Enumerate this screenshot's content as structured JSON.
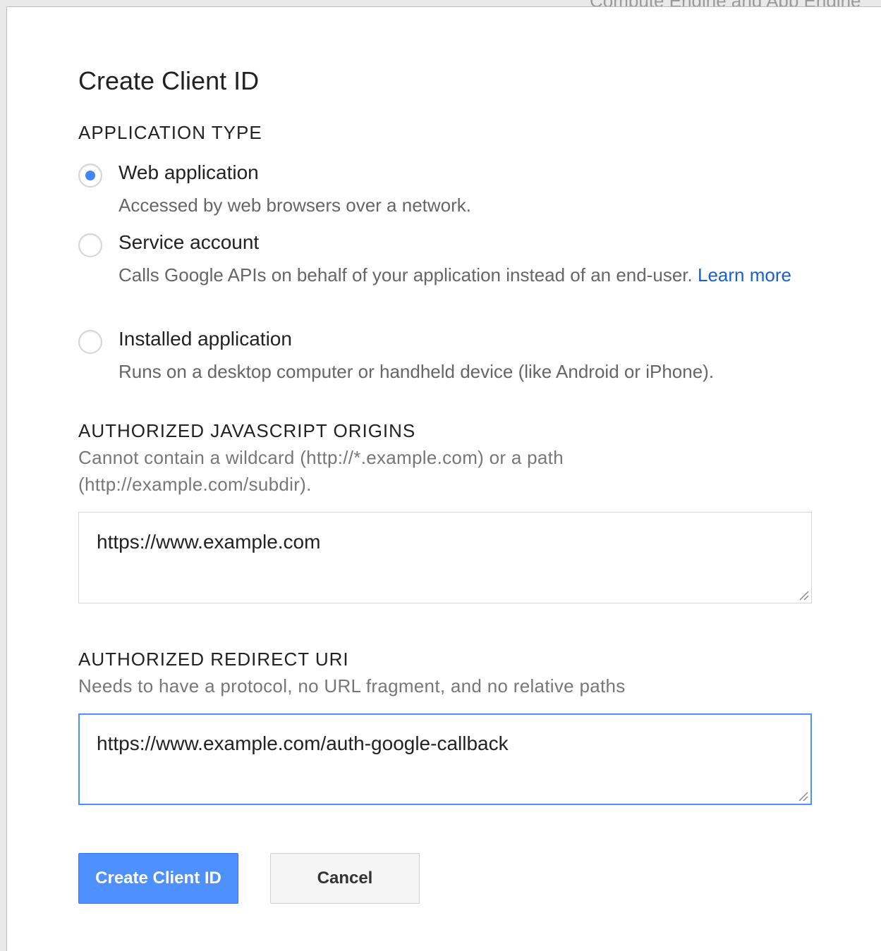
{
  "background": {
    "peek_text": "Compute Engine and App Engine"
  },
  "dialog": {
    "title": "Create Client ID",
    "application_type": {
      "label": "APPLICATION TYPE",
      "options": [
        {
          "label": "Web application",
          "description": "Accessed by web browsers over a network.",
          "checked": true
        },
        {
          "label": "Service account",
          "description": "Calls Google APIs on behalf of your application instead of an end-user.",
          "link_text": "Learn more",
          "checked": false
        },
        {
          "label": "Installed application",
          "description": "Runs on a desktop computer or handheld device (like Android or iPhone).",
          "checked": false
        }
      ]
    },
    "origins": {
      "label": "AUTHORIZED JAVASCRIPT ORIGINS",
      "help": "Cannot contain a wildcard (http://*.example.com) or a path (http://example.com/subdir).",
      "value": "https://www.example.com"
    },
    "redirect": {
      "label": "AUTHORIZED REDIRECT URI",
      "help": "Needs to have a protocol, no URL fragment, and no relative paths",
      "value": "https://www.example.com/auth-google-callback"
    },
    "buttons": {
      "create": "Create Client ID",
      "cancel": "Cancel"
    }
  },
  "colors": {
    "accent": "#4d90fe",
    "link": "#1a5fd0",
    "radio_selected": "#4285f4",
    "focus_border": "#4d90fe"
  }
}
